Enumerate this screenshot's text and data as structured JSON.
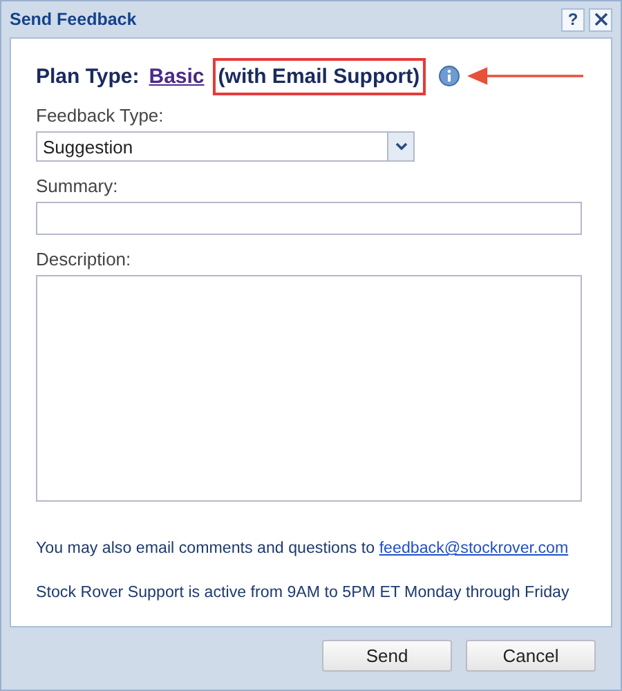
{
  "window": {
    "title": "Send Feedback",
    "help": "?"
  },
  "plan": {
    "label": "Plan Type:",
    "value": "Basic",
    "note": "(with Email Support)",
    "highlighted": true
  },
  "fields": [
    {
      "kind": "select",
      "label": "Feedback Type:",
      "value": "Suggestion"
    },
    {
      "kind": "text",
      "label": "Summary:"
    },
    {
      "kind": "textarea",
      "label": "Description:"
    }
  ],
  "info": {
    "text": "You may also email comments and questions to",
    "link": "feedback@stockrover.com",
    "hours": "Stock Rover Support is active from 9AM to 5PM ET Monday through Friday"
  },
  "buttons": [
    "Send",
    "Cancel"
  ]
}
